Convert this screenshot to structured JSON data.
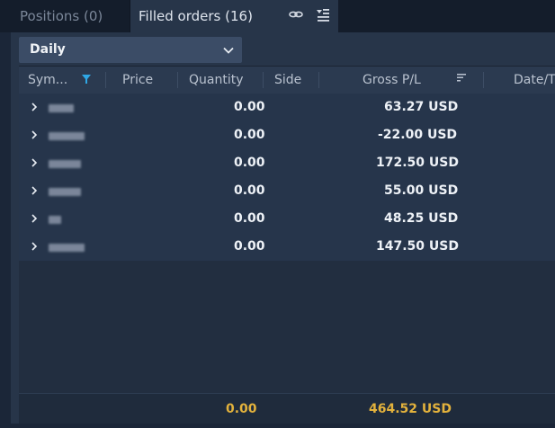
{
  "tabs": [
    {
      "label": "Positions (0)",
      "active": false
    },
    {
      "label": "Filled orders (16)",
      "active": true
    }
  ],
  "toolbar_icons": [
    "link-icon",
    "collapse-list-icon"
  ],
  "filter": {
    "selected": "Daily"
  },
  "columns": {
    "symbol": "Sym...",
    "price": "Price",
    "quantity": "Quantity",
    "side": "Side",
    "gross_pl": "Gross P/L",
    "datetime": "Date/T"
  },
  "rows": [
    {
      "quantity": "0.00",
      "gross_pl": "63.27 USD"
    },
    {
      "quantity": "0.00",
      "gross_pl": "-22.00 USD"
    },
    {
      "quantity": "0.00",
      "gross_pl": "172.50 USD"
    },
    {
      "quantity": "0.00",
      "gross_pl": "55.00 USD"
    },
    {
      "quantity": "0.00",
      "gross_pl": "48.25 USD"
    },
    {
      "quantity": "0.00",
      "gross_pl": "147.50 USD"
    }
  ],
  "totals": {
    "quantity": "0.00",
    "gross_pl": "464.52 USD"
  },
  "colors": {
    "accent_filter": "#2fa7e5",
    "totals": "#e3b23c",
    "background": "#1b2638"
  }
}
